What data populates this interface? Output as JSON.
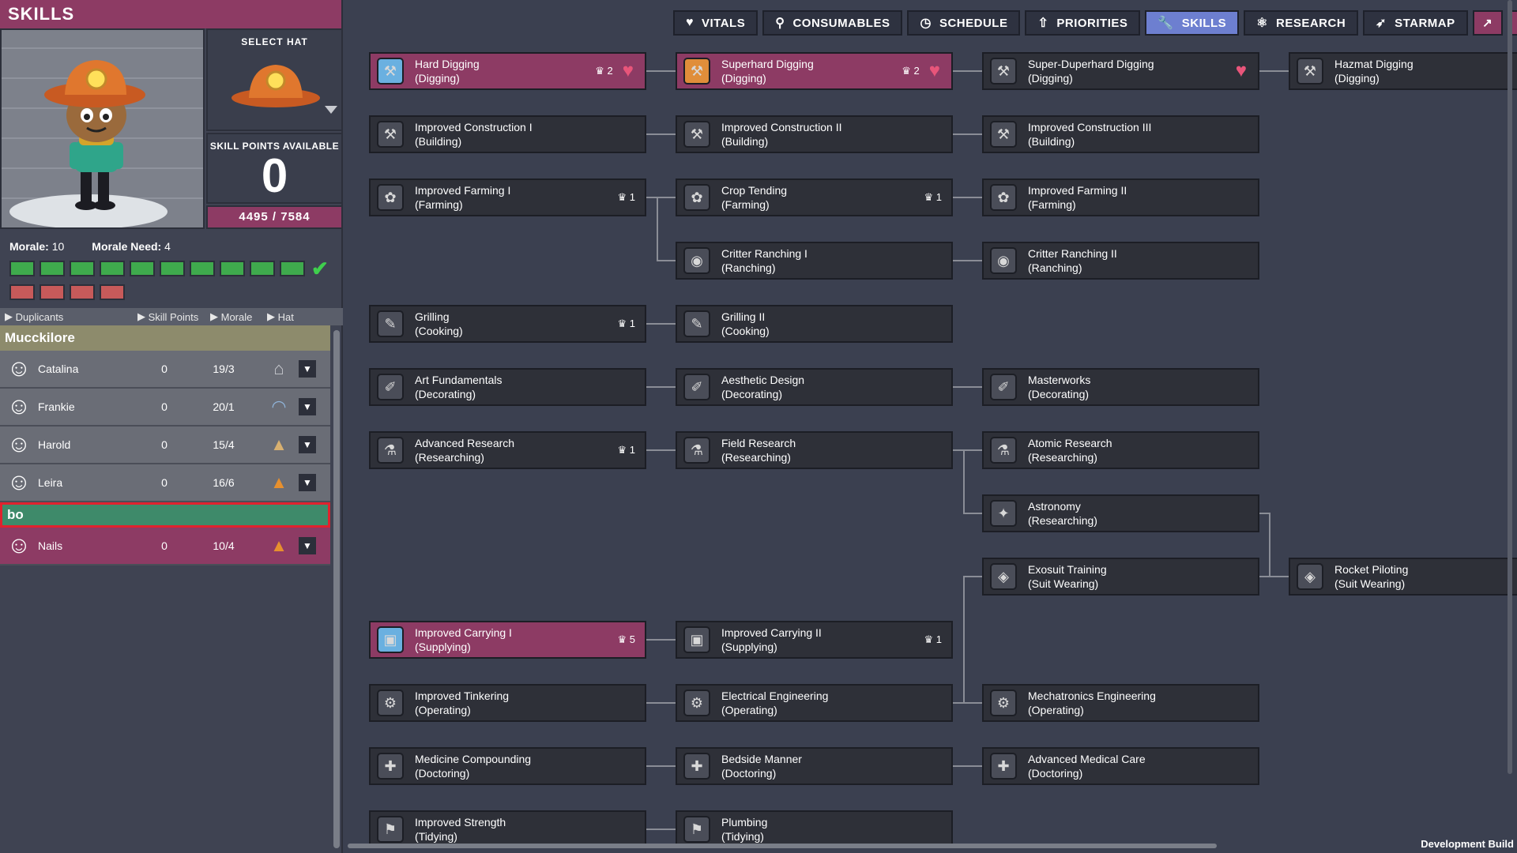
{
  "left_panel": {
    "title": "SKILLS",
    "select_hat_label": "SELECT HAT",
    "skill_points_label": "SKILL POINTS AVAILABLE",
    "skill_points_value": "0",
    "xp": "4495 / 7584",
    "morale_label": "Morale:",
    "morale_value": "10",
    "morale_need_label": "Morale Need:",
    "morale_need_value": "4",
    "sort": {
      "duplicants": "Duplicants",
      "skill_points": "Skill Points",
      "morale": "Morale",
      "hat": "Hat"
    },
    "group_name": "Mucckilore",
    "new_group_input": "bo",
    "dupes": [
      {
        "name": "Catalina",
        "points": "0",
        "ratio": "19/3"
      },
      {
        "name": "Frankie",
        "points": "0",
        "ratio": "20/1"
      },
      {
        "name": "Harold",
        "points": "0",
        "ratio": "15/4"
      },
      {
        "name": "Leira",
        "points": "0",
        "ratio": "16/6"
      },
      {
        "name": "Nails",
        "points": "0",
        "ratio": "10/4"
      }
    ]
  },
  "tabs": {
    "vitals": "VITALS",
    "consumables": "CONSUMABLES",
    "schedule": "SCHEDULE",
    "priorities": "PRIORITIES",
    "skills": "SKILLS",
    "research": "RESEARCH",
    "starmap": "STARMAP"
  },
  "skills": {
    "hard_digging": {
      "name": "Hard Digging",
      "group": "(Digging)",
      "count": "2"
    },
    "superhard_digging": {
      "name": "Superhard Digging",
      "group": "(Digging)",
      "count": "2"
    },
    "super_duperhard_digging": {
      "name": "Super-Duperhard Digging",
      "group": "(Digging)"
    },
    "hazmat_digging": {
      "name": "Hazmat Digging",
      "group": "(Digging)"
    },
    "improved_construction_1": {
      "name": "Improved Construction I",
      "group": "(Building)"
    },
    "improved_construction_2": {
      "name": "Improved Construction II",
      "group": "(Building)"
    },
    "improved_construction_3": {
      "name": "Improved Construction III",
      "group": "(Building)"
    },
    "improved_farming_1": {
      "name": "Improved Farming I",
      "group": "(Farming)",
      "count": "1"
    },
    "crop_tending": {
      "name": "Crop Tending",
      "group": "(Farming)",
      "count": "1"
    },
    "improved_farming_2": {
      "name": "Improved Farming II",
      "group": "(Farming)"
    },
    "critter_ranching_1": {
      "name": "Critter Ranching I",
      "group": "(Ranching)"
    },
    "critter_ranching_2": {
      "name": "Critter Ranching II",
      "group": "(Ranching)"
    },
    "grilling": {
      "name": "Grilling",
      "group": "(Cooking)",
      "count": "1"
    },
    "grilling_2": {
      "name": "Grilling II",
      "group": "(Cooking)"
    },
    "art_fundamentals": {
      "name": "Art Fundamentals",
      "group": "(Decorating)"
    },
    "aesthetic_design": {
      "name": "Aesthetic Design",
      "group": "(Decorating)"
    },
    "masterworks": {
      "name": "Masterworks",
      "group": "(Decorating)"
    },
    "advanced_research": {
      "name": "Advanced Research",
      "group": "(Researching)",
      "count": "1"
    },
    "field_research": {
      "name": "Field Research",
      "group": "(Researching)"
    },
    "atomic_research": {
      "name": "Atomic Research",
      "group": "(Researching)"
    },
    "astronomy": {
      "name": "Astronomy",
      "group": "(Researching)"
    },
    "exosuit_training": {
      "name": "Exosuit Training",
      "group": "(Suit Wearing)"
    },
    "rocket_piloting": {
      "name": "Rocket Piloting",
      "group": "(Suit Wearing)"
    },
    "improved_carrying_1": {
      "name": "Improved Carrying I",
      "group": "(Supplying)",
      "count": "5"
    },
    "improved_carrying_2": {
      "name": "Improved Carrying II",
      "group": "(Supplying)",
      "count": "1"
    },
    "improved_tinkering": {
      "name": "Improved Tinkering",
      "group": "(Operating)"
    },
    "electrical_engineering": {
      "name": "Electrical Engineering",
      "group": "(Operating)"
    },
    "mechatronics_engineering": {
      "name": "Mechatronics Engineering",
      "group": "(Operating)"
    },
    "medicine_compounding": {
      "name": "Medicine Compounding",
      "group": "(Doctoring)"
    },
    "bedside_manner": {
      "name": "Bedside Manner",
      "group": "(Doctoring)"
    },
    "advanced_medical_care": {
      "name": "Advanced Medical Care",
      "group": "(Doctoring)"
    },
    "improved_strength": {
      "name": "Improved Strength",
      "group": "(Tidying)"
    },
    "plumbing": {
      "name": "Plumbing",
      "group": "(Tidying)"
    }
  },
  "footer": {
    "dev_build": "Development Build"
  },
  "colors": {
    "accent": "#8d3b64",
    "active_tab": "#6d7fd0",
    "morale_green": "#3faa4d",
    "morale_red": "#c75a5a"
  }
}
